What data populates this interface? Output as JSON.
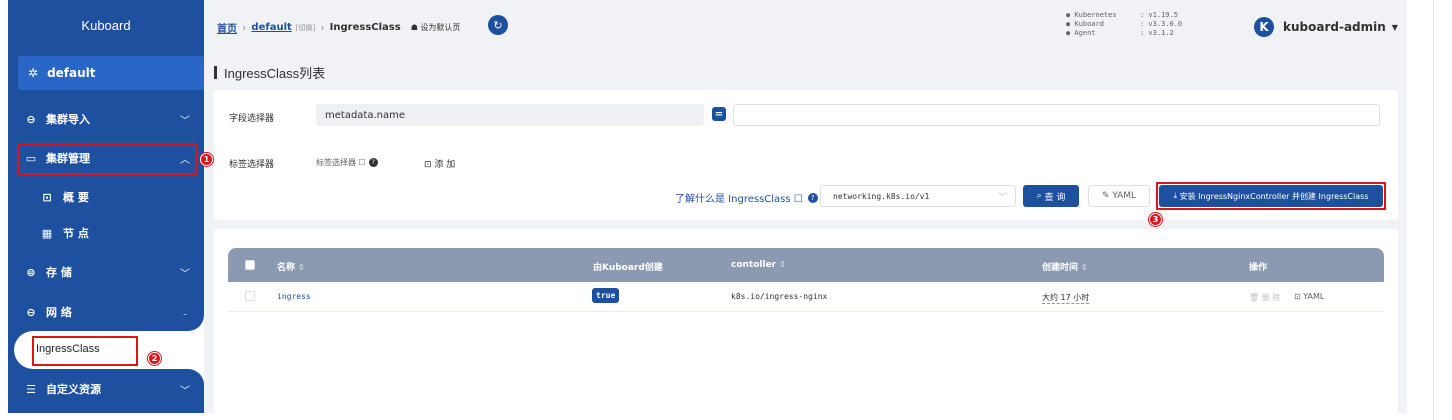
{
  "sidebar": {
    "brand": "Kuboard",
    "namespace": "default",
    "items": [
      {
        "label": "集群导入",
        "icon": "cluster-import-icon",
        "chev": "﹀"
      },
      {
        "label": "集群管理",
        "icon": "cluster-manage-icon",
        "chev": "︿"
      },
      {
        "label": "概 要",
        "icon": "overview-icon"
      },
      {
        "label": "节 点",
        "icon": "nodes-icon"
      },
      {
        "label": "存 储",
        "icon": "storage-icon",
        "chev": "﹀"
      },
      {
        "label": "网 络",
        "icon": "network-icon",
        "chev": "︿"
      },
      {
        "label": "IngressClass"
      },
      {
        "label": "自定义资源",
        "icon": "custom-resource-icon",
        "chev": "﹀"
      }
    ]
  },
  "markers": [
    "1",
    "2",
    "3"
  ],
  "header": {
    "home": "首页",
    "namespace": "default",
    "switch": "[切换]",
    "current": "IngressClass",
    "set_default": "设为默认页",
    "versions": [
      {
        "k": "● Kubernetes",
        "v": ": v1.19.5"
      },
      {
        "k": "● Kuboard",
        "v": ": v3.3.0.0"
      },
      {
        "k": "● Agent",
        "v": ": v3.1.2"
      }
    ],
    "avatar": "K",
    "user": "kuboard-admin"
  },
  "page_title": "IngressClass列表",
  "filters": {
    "field_label": "字段选择器",
    "field_value": "metadata.name",
    "operator": "=",
    "field_input": "",
    "tag_label": "标签选择器",
    "tag_selector_link": "标签选择器 ☐",
    "add": "添 加",
    "learn": "了解什么是 IngressClass ☐",
    "api_version": "networking.k8s.io/v1",
    "query_btn": "查 询",
    "yaml_btn": "YAML",
    "install_btn": "安装 IngressNginxController 并创建 IngressClass"
  },
  "table": {
    "headers": {
      "name": "名称",
      "by_kuboard": "由Kuboard创建",
      "controller": "contoller",
      "created": "创建时间",
      "actions": "操作"
    },
    "rows": [
      {
        "name": "ingress",
        "by_kuboard": "true",
        "controller": "k8s.io/ingress-nginx",
        "created": "大约 17 小时",
        "delete": "删 除",
        "yaml": "YAML"
      }
    ]
  },
  "colors": {
    "primary": "#1e50a0",
    "highlight": "#d9161c",
    "table_header": "#8c9ab1"
  }
}
